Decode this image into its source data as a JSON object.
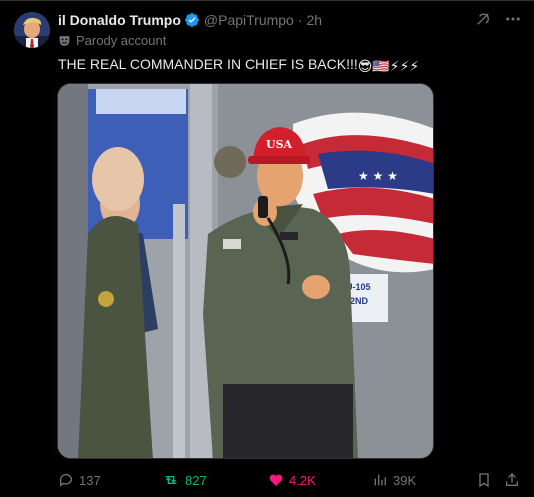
{
  "post": {
    "display_name": "il Donaldo Trumpo",
    "handle": "@PapiTrumpo",
    "separator": "·",
    "time": "2h",
    "parody_label": "Parody account",
    "text": "THE REAL COMMANDER IN CHIEF IS BACK!!!",
    "emojis": "😎🇺🇸⚡⚡⚡",
    "hat_text": "USA",
    "sign_text_line1": "U-105",
    "sign_text_line2": "2ND"
  },
  "actions": {
    "replies": "137",
    "reposts": "827",
    "likes": "4.2K",
    "views": "39K"
  },
  "colors": {
    "background": "#000000",
    "text": "#e7e9ea",
    "muted": "#71767b",
    "verified": "#1d9bf0",
    "repost_active": "#00ba7c",
    "like_active": "#f91880"
  },
  "icons": {
    "verified": "verified-badge-icon",
    "grok": "grok-icon",
    "more": "more-icon",
    "parody": "parody-mask-icon",
    "reply": "reply-icon",
    "repost": "repost-icon",
    "like": "heart-icon",
    "views": "views-icon",
    "bookmark": "bookmark-icon",
    "share": "share-icon"
  }
}
